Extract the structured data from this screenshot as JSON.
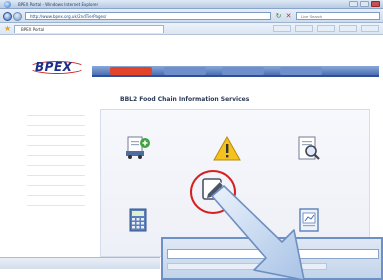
{
  "window": {
    "title": "BPEX Portal - Windows Internet Explorer",
    "url": "http://www.bpex.org.uk/2ndTierPages/",
    "search_placeholder": "Live Search",
    "tab_label": "BPEX Portal"
  },
  "site": {
    "logo": "BPEX",
    "nav_tabs": [
      "",
      "",
      "",
      ""
    ],
    "heading": "BBL2 Food Chain Information Services"
  },
  "sidebar": {
    "items": [
      "",
      "",
      "",
      "",
      "",
      "",
      "",
      "",
      "",
      ""
    ]
  },
  "services": [
    {
      "icon": "truck-document-icon",
      "caption": ""
    },
    {
      "icon": "warning-triangle-icon",
      "caption": ""
    },
    {
      "icon": "magnify-document-icon",
      "caption": ""
    },
    {
      "icon": "calculator-icon",
      "caption": ""
    },
    {
      "icon": "edit-pencil-icon",
      "caption": ""
    },
    {
      "icon": "report-document-icon",
      "caption": ""
    }
  ],
  "colors": {
    "accent_red": "#d61f1f",
    "nav_blue": "#4a6fb3",
    "brand_navy": "#1b2f8a"
  }
}
